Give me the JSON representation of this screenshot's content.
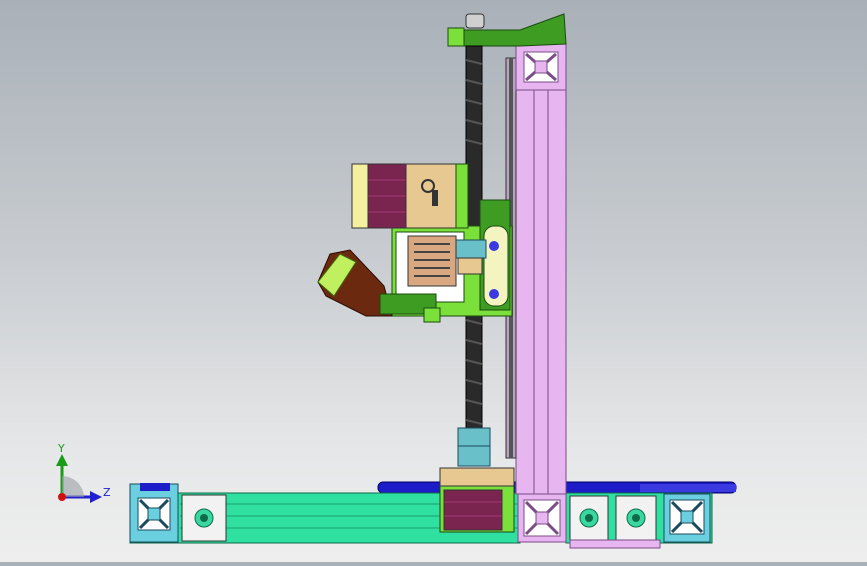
{
  "viewport": {
    "background_top": "#a9b0b8",
    "background_bottom": "#eeeeee"
  },
  "triad": {
    "y_label": "Y",
    "z_label": "Z",
    "y_color": "#1a9c1a",
    "z_color": "#2020d0",
    "origin_color": "#d01010"
  },
  "colors": {
    "frame_violet": "#e7b5ef",
    "frame_violet_edge": "#7a4c88",
    "base_green": "#2fe0a0",
    "base_green_dark": "#18a070",
    "motor_purple": "#7a2450",
    "motor_tan": "#e6c890",
    "part_green": "#7be03a",
    "part_dark_green": "#3e9c22",
    "leadscrew": "#2a2a2a",
    "blue_plate": "#1c1cc8",
    "coupler": "#6ac0c8",
    "extruder_brown": "#6b2a10",
    "fan_wood": "#d9a880"
  },
  "model": {
    "components": [
      "top-bracket",
      "vertical-frame-rail",
      "z-leadscrew",
      "x-carriage",
      "extruder-motor",
      "hotend-fan",
      "extruder-nozzle",
      "z-coupler",
      "z-motor",
      "base-rail",
      "base-plate"
    ]
  }
}
